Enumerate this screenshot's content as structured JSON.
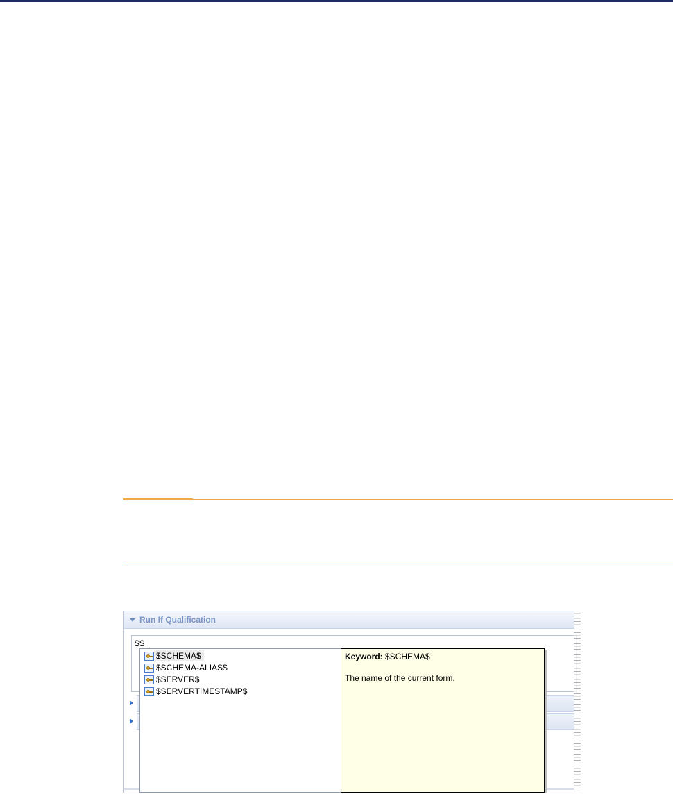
{
  "figure": {
    "section_title": "Run If Qualification",
    "input_value": "$S",
    "autocomplete": {
      "items": [
        {
          "label": "$SCHEMA$",
          "icon": "keyword-icon",
          "selected": true
        },
        {
          "label": "$SCHEMA-ALIAS$",
          "icon": "keyword-icon",
          "selected": false
        },
        {
          "label": "$SERVER$",
          "icon": "keyword-icon",
          "selected": false
        },
        {
          "label": "$SERVERTIMESTAMP$",
          "icon": "keyword-icon",
          "selected": false
        }
      ],
      "tooltip": {
        "keyword_label": "Keyword:",
        "keyword_value": "$SCHEMA$",
        "description": "The name of the current form."
      }
    }
  },
  "colors": {
    "top_rule": "#1f2a6b",
    "note_rule": "#f0a848",
    "section_title": "#7a95c4",
    "tooltip_bg": "#ffffe8"
  }
}
